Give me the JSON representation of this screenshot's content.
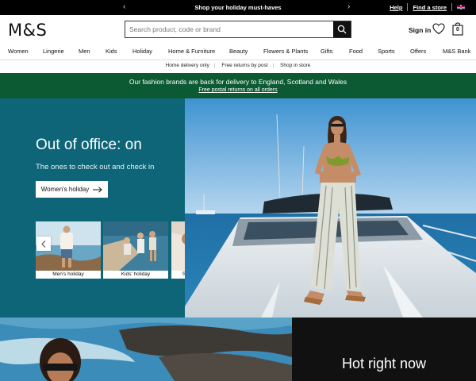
{
  "promo": {
    "text": "Shop your holiday must-haves",
    "help": "Help",
    "find_store": "Find a store"
  },
  "header": {
    "logo": "M&S",
    "search_placeholder": "Search product, code or brand",
    "sign_in": "Sign in",
    "bag_count": "0"
  },
  "nav": {
    "items": [
      "Women",
      "Lingerie",
      "Men",
      "Kids",
      "Holiday",
      "Home & Furniture",
      "Beauty",
      "Flowers & Plants",
      "Gifts",
      "Food",
      "Sports",
      "Offers",
      "M&S Bank"
    ]
  },
  "service": {
    "items": [
      "Home delivery only",
      "Free returns by post",
      "Shop in store"
    ]
  },
  "banner": {
    "line1": "Our fashion brands are back for delivery to England, Scotland and Wales",
    "line2": "Free postal returns on all orders",
    "color": "#0c5a33"
  },
  "hero": {
    "title": "Out of office: on",
    "subtitle": "The ones to check out and check in",
    "button": "Women's holiday",
    "panel_color": "#0d6577",
    "tiles": [
      {
        "caption": "Men's holiday"
      },
      {
        "caption": "Kids' holiday"
      },
      {
        "caption": "Summer nightwear"
      }
    ]
  },
  "lower": {
    "title": "Hot right now"
  }
}
